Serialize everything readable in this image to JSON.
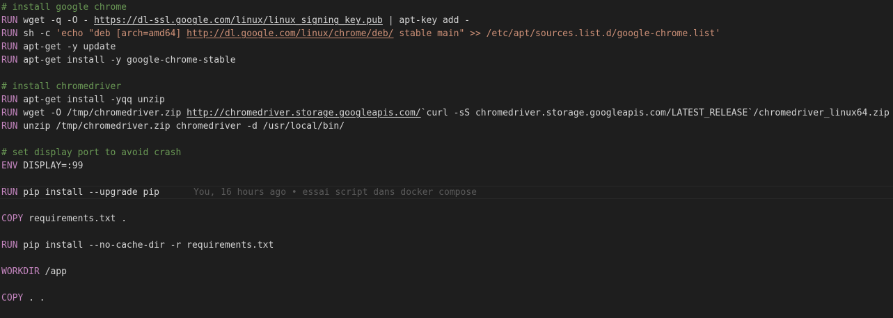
{
  "editor": {
    "lines": [
      [
        {
          "t": "# install google chrome",
          "c": "comment"
        }
      ],
      [
        {
          "t": "RUN",
          "c": "kw"
        },
        {
          "t": " wget -q -O - ",
          "c": "txt"
        },
        {
          "t": "https://dl-ssl.google.com/linux/linux_signing_key.pub",
          "c": "link",
          "i": true
        },
        {
          "t": " | apt-key add -",
          "c": "txt"
        }
      ],
      [
        {
          "t": "RUN",
          "c": "kw"
        },
        {
          "t": " sh -c ",
          "c": "txt"
        },
        {
          "t": "'echo \"deb [arch=amd64] ",
          "c": "str"
        },
        {
          "t": "http://dl.google.com/linux/chrome/deb/",
          "c": "link str",
          "i": true
        },
        {
          "t": " stable main\" >> /etc/apt/sources.list.d/google-chrome.list'",
          "c": "str"
        }
      ],
      [
        {
          "t": "RUN",
          "c": "kw"
        },
        {
          "t": " apt-get -y update",
          "c": "txt"
        }
      ],
      [
        {
          "t": "RUN",
          "c": "kw"
        },
        {
          "t": " apt-get install -y google-chrome-stable",
          "c": "txt"
        }
      ],
      [],
      [
        {
          "t": "# install chromedriver",
          "c": "comment"
        }
      ],
      [
        {
          "t": "RUN",
          "c": "kw"
        },
        {
          "t": " apt-get install -yqq unzip",
          "c": "txt"
        }
      ],
      [
        {
          "t": "RUN",
          "c": "kw"
        },
        {
          "t": " wget -O /tmp/chromedriver.zip ",
          "c": "txt"
        },
        {
          "t": "http://chromedriver.storage.googleapis.com/",
          "c": "link",
          "i": true
        },
        {
          "t": "`curl -sS chromedriver.storage.googleapis.com/LATEST_RELEASE`/chromedriver_linux64.zip",
          "c": "txt"
        }
      ],
      [
        {
          "t": "RUN",
          "c": "kw"
        },
        {
          "t": " unzip /tmp/chromedriver.zip chromedriver -d /usr/local/bin/",
          "c": "txt"
        }
      ],
      [],
      [
        {
          "t": "# set display port to avoid crash",
          "c": "comment"
        }
      ],
      [
        {
          "t": "ENV",
          "c": "kw"
        },
        {
          "t": " DISPLAY=:99",
          "c": "txt"
        }
      ],
      [],
      [
        {
          "t": "RUN",
          "c": "kw"
        },
        {
          "t": " pip install --upgrade pip",
          "c": "txt"
        },
        {
          "t": "You, 16 hours ago • essai script dans docker compose",
          "c": "blame",
          "current": true
        }
      ],
      [],
      [
        {
          "t": "COPY",
          "c": "kw"
        },
        {
          "t": " requirements.txt .",
          "c": "txt"
        }
      ],
      [],
      [
        {
          "t": "RUN",
          "c": "kw"
        },
        {
          "t": " pip install --no-cache-dir -r requirements.txt",
          "c": "txt"
        }
      ],
      [],
      [
        {
          "t": "WORKDIR",
          "c": "kw"
        },
        {
          "t": " /app",
          "c": "txt"
        }
      ],
      [],
      [
        {
          "t": "COPY",
          "c": "kw"
        },
        {
          "t": " . .",
          "c": "txt"
        }
      ]
    ]
  }
}
